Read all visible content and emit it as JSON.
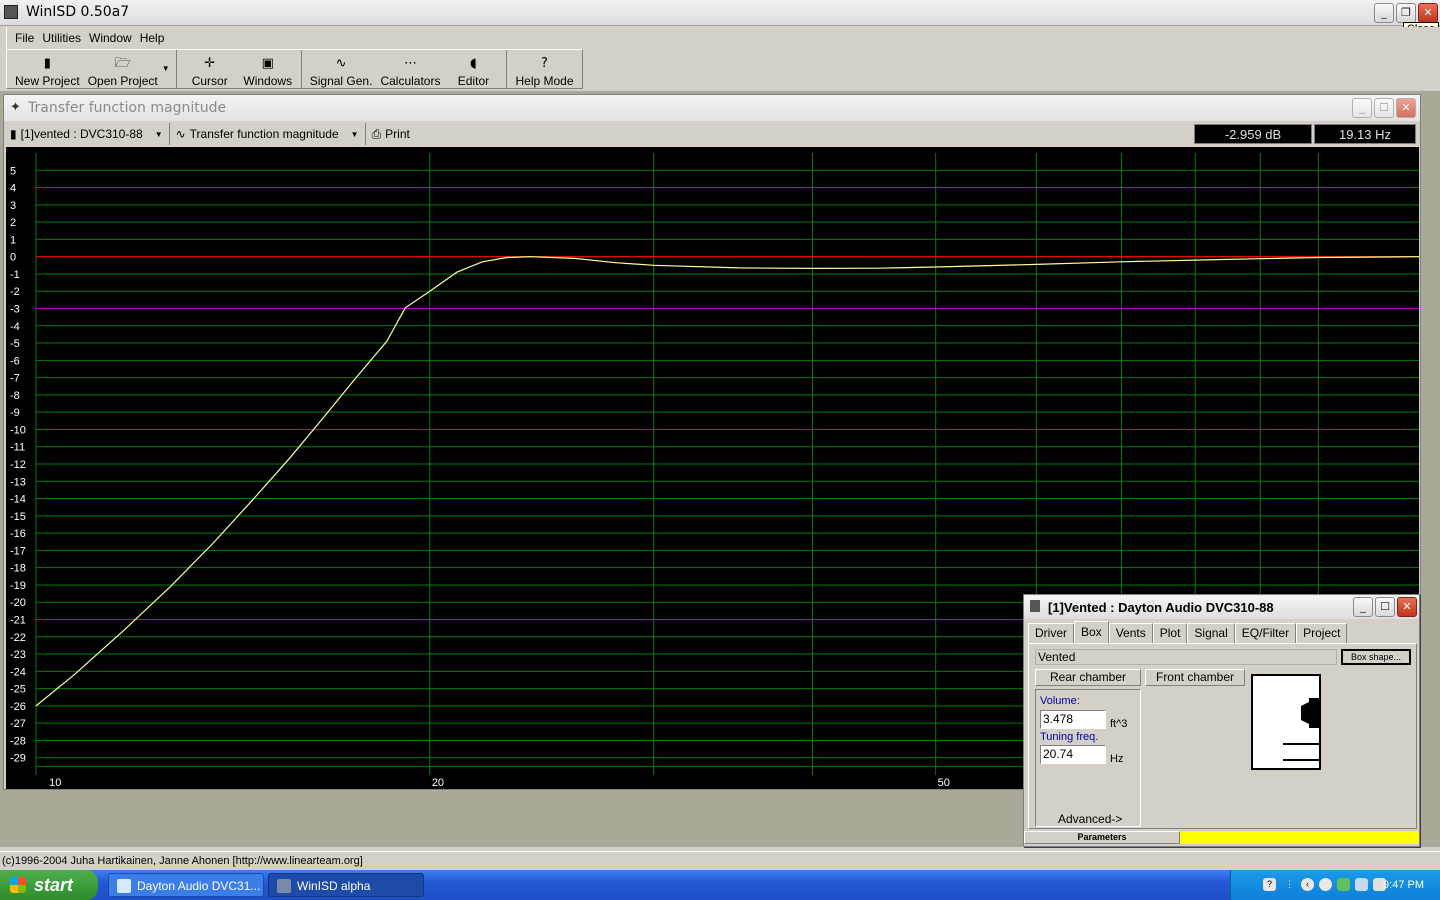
{
  "app": {
    "title": "WinISD 0.50a7",
    "tooltip": "Close"
  },
  "menu": [
    "File",
    "Utilities",
    "Window",
    "Help"
  ],
  "toolbar": {
    "new_project": "New Project",
    "open_project": "Open Project",
    "cursor": "Cursor",
    "windows": "Windows",
    "signal_gen": "Signal Gen.",
    "calculators": "Calculators",
    "editor": "Editor",
    "help_mode": "Help Mode"
  },
  "chart_window": {
    "title": "Transfer function magnitude",
    "project_select": "[1]vented : DVC310-88",
    "graph_select": "Transfer function magnitude",
    "print": "Print",
    "readout_db": "-2.959 dB",
    "readout_hz": "19.13 Hz"
  },
  "chart_data": {
    "type": "line",
    "title": "",
    "xlabel": "",
    "ylabel": "",
    "x_scale": "log",
    "xlim": [
      9.8,
      120
    ],
    "ylim": [
      -30,
      6
    ],
    "x_tick_labels": [
      {
        "value": 10,
        "label": "10"
      },
      {
        "value": 20,
        "label": "20"
      },
      {
        "value": 50,
        "label": "50"
      }
    ],
    "x_grid": [
      20,
      30,
      40,
      50,
      60,
      70,
      80,
      90,
      100
    ],
    "y_ticks": [
      5,
      4,
      3,
      2,
      1,
      0,
      -1,
      -2,
      -3,
      -4,
      -5,
      -6,
      -7,
      -8,
      -9,
      -10,
      -11,
      -12,
      -13,
      -14,
      -15,
      -16,
      -17,
      -18,
      -19,
      -20,
      -21,
      -22,
      -23,
      -24,
      -25,
      -26,
      -27,
      -28,
      -29
    ],
    "grid": true,
    "reference_lines": [
      {
        "y": 0,
        "color": "#ff0000"
      },
      {
        "y": -3,
        "color": "#c000c0"
      }
    ],
    "series": [
      {
        "color": "#ffff99",
        "points": [
          [
            9.8,
            -26
          ],
          [
            10.5,
            -24.2
          ],
          [
            11.5,
            -21.6
          ],
          [
            12.5,
            -19.1
          ],
          [
            13.5,
            -16.6
          ],
          [
            14.5,
            -14.1
          ],
          [
            15.5,
            -11.7
          ],
          [
            16.5,
            -9.3
          ],
          [
            17.5,
            -7
          ],
          [
            18.5,
            -4.9
          ],
          [
            19.13,
            -2.959
          ],
          [
            20,
            -2
          ],
          [
            21,
            -0.9
          ],
          [
            22,
            -0.3
          ],
          [
            23,
            -0.05
          ],
          [
            24,
            0
          ],
          [
            26,
            -0.1
          ],
          [
            28,
            -0.35
          ],
          [
            30,
            -0.5
          ],
          [
            35,
            -0.65
          ],
          [
            40,
            -0.68
          ],
          [
            45,
            -0.67
          ],
          [
            50,
            -0.6
          ],
          [
            60,
            -0.45
          ],
          [
            70,
            -0.3
          ],
          [
            80,
            -0.2
          ],
          [
            90,
            -0.12
          ],
          [
            100,
            -0.05
          ],
          [
            120,
            0
          ]
        ]
      }
    ]
  },
  "box_window": {
    "title": "[1]Vented : Dayton Audio DVC310-88",
    "tabs": [
      "Driver",
      "Box",
      "Vents",
      "Plot",
      "Signal",
      "EQ/Filter",
      "Project"
    ],
    "box_type": "Vented",
    "box_shape_button": "Box shape...",
    "rear_chamber": "Rear chamber",
    "front_chamber": "Front chamber",
    "volume_label": "Volume:",
    "volume_value": "3.478",
    "volume_unit": "ft^3",
    "tuning_label": "Tuning freq.",
    "tuning_value": "20.74",
    "tuning_unit": "Hz",
    "advanced": "Advanced->",
    "parameters": "Parameters"
  },
  "status": {
    "text": "(c)1996-2004 Juha Hartikainen, Janne Ahonen [http://www.linearteam.org]"
  },
  "taskbar": {
    "start": "start",
    "tasks": [
      "Dayton Audio DVC31...",
      "WinISD alpha"
    ],
    "clock": "9:47 PM"
  }
}
